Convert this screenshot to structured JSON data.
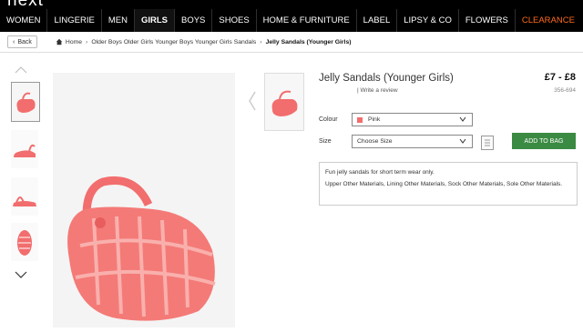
{
  "brand": {
    "logo": "next"
  },
  "nav": {
    "items": [
      {
        "label": "WOMEN"
      },
      {
        "label": "LINGERIE"
      },
      {
        "label": "MEN"
      },
      {
        "label": "GIRLS"
      },
      {
        "label": "BOYS"
      },
      {
        "label": "SHOES"
      },
      {
        "label": "HOME & FURNITURE"
      },
      {
        "label": "LABEL"
      },
      {
        "label": "LIPSY & CO"
      },
      {
        "label": "FLOWERS"
      },
      {
        "label": "CLEARANCE"
      }
    ],
    "active": "GIRLS"
  },
  "breadcrumb": {
    "back_label": "Back",
    "home": "Home",
    "path": "Older Boys Older Girls Younger Boys Younger Girls Sandals",
    "current": "Jelly Sandals (Younger Girls)"
  },
  "product": {
    "title": "Jelly Sandals (Younger Girls)",
    "price": "£7 - £8",
    "review_link": "Write a review",
    "code": "356-694",
    "colour_label": "Colour",
    "colour_value": "Pink",
    "size_label": "Size",
    "size_value": "Choose Size",
    "add_to_bag": "ADD TO BAG",
    "description": "Fun jelly sandals for short term wear only.",
    "materials": "Upper Other Materials, Lining Other Materials, Sock Other Materials, Sole Other Materials."
  },
  "colors": {
    "nav_bg": "#000000",
    "clearance": "#ff6a1a",
    "add_button": "#3b8a43",
    "sandal": "#f26d6d"
  },
  "icons": [
    "home-icon",
    "chevron-up-icon",
    "chevron-down-icon",
    "chevron-left-icon",
    "size-guide-icon"
  ]
}
